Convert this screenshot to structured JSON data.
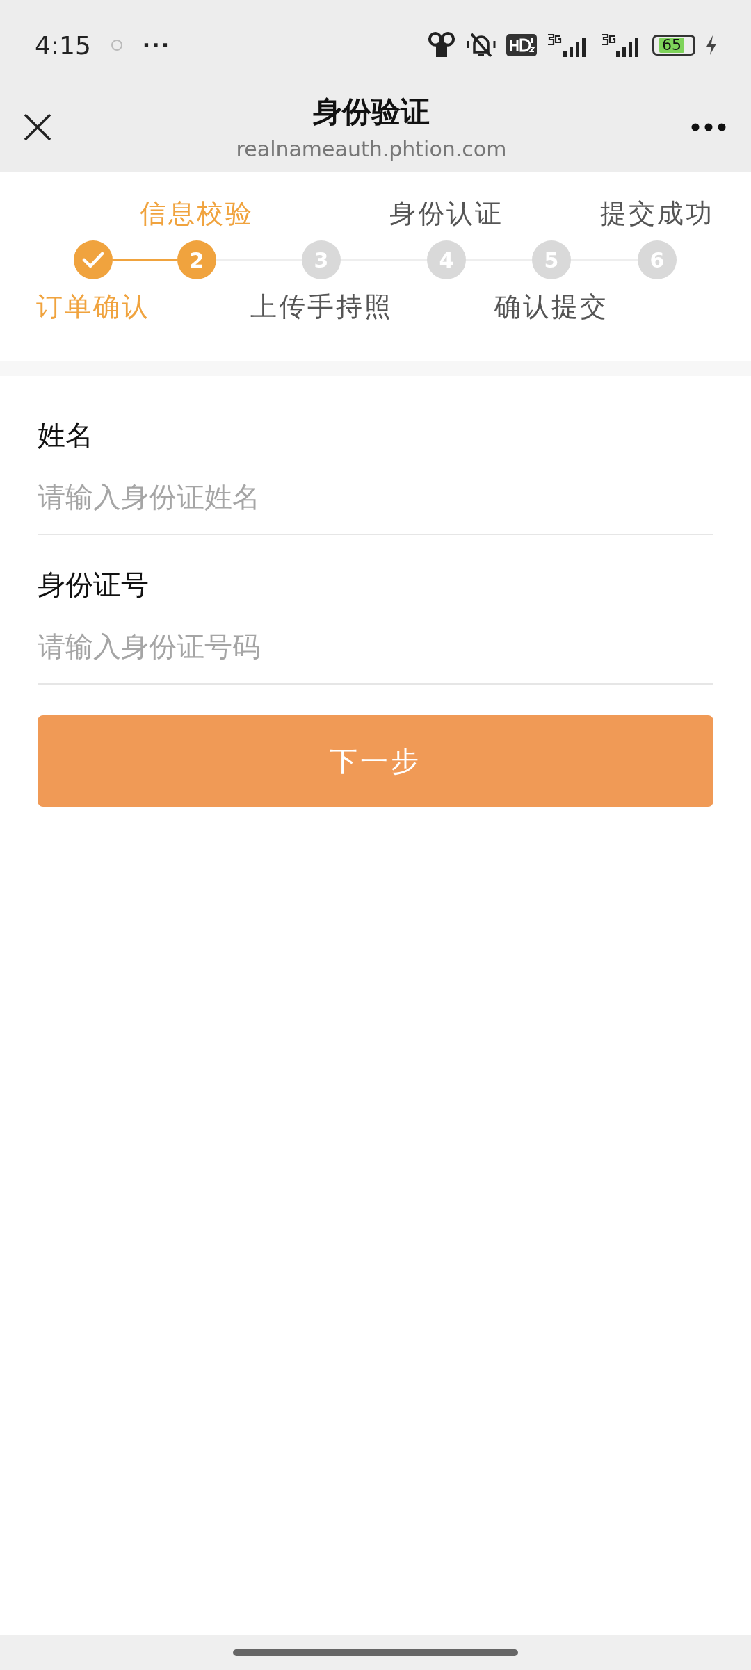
{
  "status_bar": {
    "time": "4:15",
    "more": "···",
    "battery": "65"
  },
  "nav_bar": {
    "title": "身份验证",
    "url": "realnameauth.phtion.com"
  },
  "steps": [
    {
      "label": "订单确认",
      "done": true,
      "selected": false
    },
    {
      "number": "2",
      "label": "信息校验",
      "done": false,
      "selected": true
    },
    {
      "number": "3",
      "label": "上传手持照",
      "done": false,
      "selected": false
    },
    {
      "number": "4",
      "label": "身份认证",
      "done": false,
      "selected": false
    },
    {
      "number": "5",
      "label": "确认提交",
      "done": false,
      "selected": false
    },
    {
      "number": "6",
      "label": "提交成功",
      "done": false,
      "selected": false
    }
  ],
  "fields": [
    {
      "label": "姓名",
      "placeholder": "请输入身份证姓名"
    },
    {
      "label": "身份证号",
      "placeholder": "请输入身份证号码"
    }
  ],
  "next_button": "下一步"
}
